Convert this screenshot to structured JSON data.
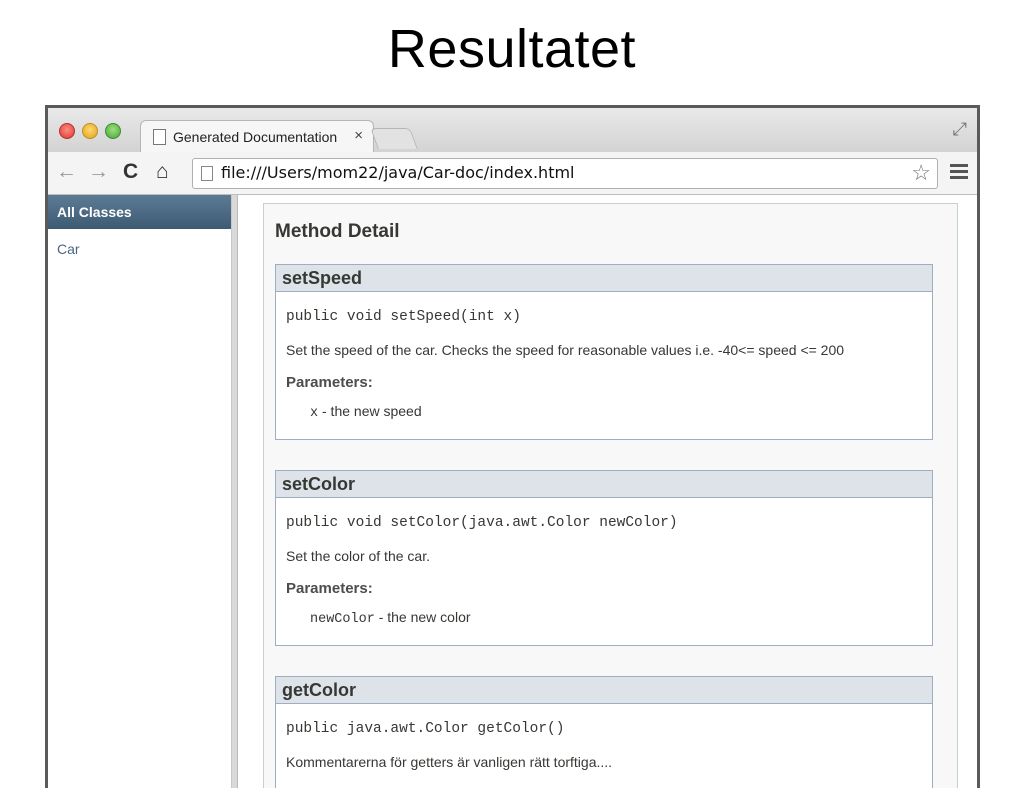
{
  "slide": {
    "title": "Resultatet"
  },
  "browser": {
    "tab": {
      "title": "Generated Documentation",
      "close": "×"
    },
    "toolbar": {
      "back": "←",
      "forward": "→",
      "reload": "C",
      "home": "⌂",
      "url": "file:///Users/mom22/java/Car-doc/index.html",
      "star": "☆"
    }
  },
  "sidebar": {
    "header": "All Classes",
    "items": [
      {
        "label": "Car"
      }
    ]
  },
  "main": {
    "section_title": "Method Detail",
    "methods": [
      {
        "name": "setSpeed",
        "signature": "public void setSpeed(int x)",
        "description": "Set the speed of the car. Checks the speed for reasonable values i.e. -40<= speed <= 200",
        "params_label": "Parameters:",
        "param_name": "x",
        "param_desc": " - the new speed"
      },
      {
        "name": "setColor",
        "signature": "public void setColor(java.awt.Color newColor)",
        "description": "Set the color of the car.",
        "params_label": "Parameters:",
        "param_name": "newColor",
        "param_desc": " - the new color"
      },
      {
        "name": "getColor",
        "signature": "public java.awt.Color getColor()",
        "description": "Kommentarerna för getters är vanligen rätt torftiga...."
      }
    ]
  }
}
